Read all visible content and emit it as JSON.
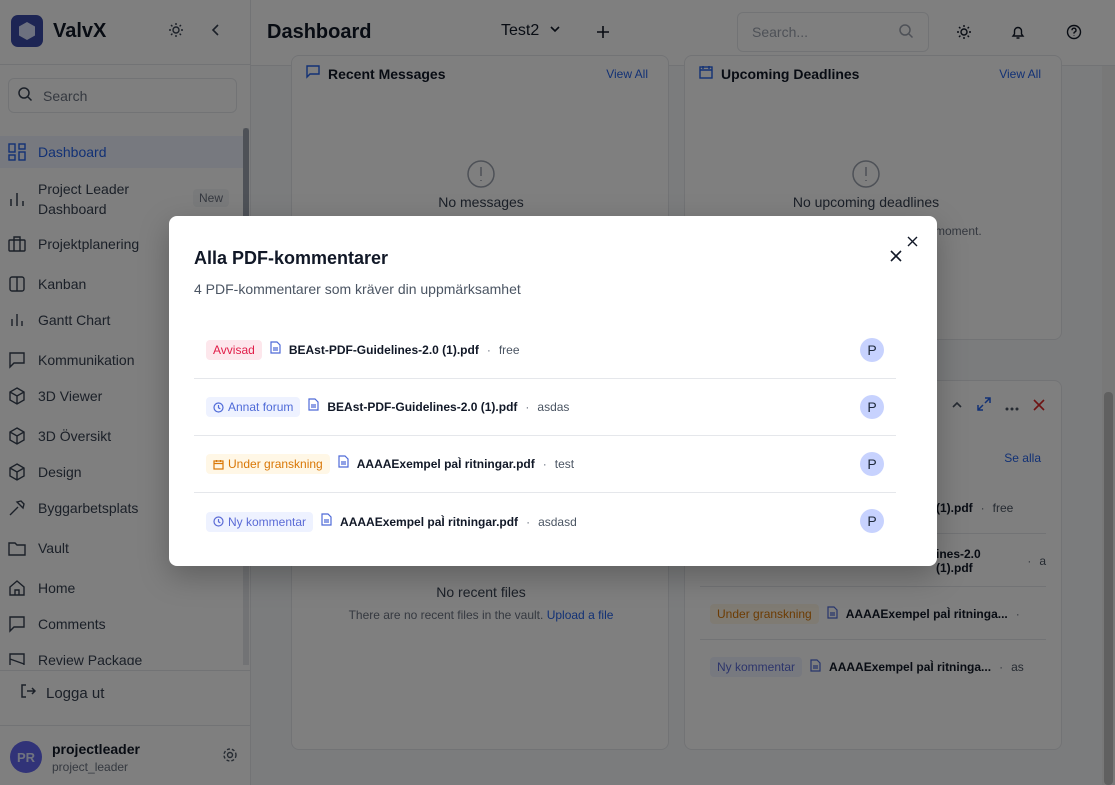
{
  "brand": {
    "name": "ValvX"
  },
  "sidebar": {
    "search_label": "Search",
    "items": [
      {
        "label": "Dashboard",
        "icon": "dashboard-icon",
        "active": true
      },
      {
        "label": "Project Leader Dashboard",
        "icon": "bar-chart-icon",
        "badge": "New"
      },
      {
        "label": "Projektplanering",
        "icon": "briefcase-icon"
      },
      {
        "label": "Kanban",
        "icon": "columns-icon"
      },
      {
        "label": "Gantt Chart",
        "icon": "gantt-icon"
      },
      {
        "label": "Kommunikation",
        "icon": "message-icon"
      },
      {
        "label": "3D Viewer",
        "icon": "cube-icon"
      },
      {
        "label": "3D Översikt",
        "icon": "cube-icon"
      },
      {
        "label": "Design",
        "icon": "cube-icon"
      },
      {
        "label": "Byggarbetsplats",
        "icon": "hammer-icon"
      },
      {
        "label": "Vault",
        "icon": "folder-icon"
      },
      {
        "label": "Home",
        "icon": "home-icon"
      },
      {
        "label": "Comments",
        "icon": "comment-icon"
      },
      {
        "label": "Review Package",
        "icon": "package-icon"
      }
    ],
    "logout_label": "Logga ut",
    "user": {
      "initials": "PR",
      "name": "projectleader",
      "role": "project_leader"
    }
  },
  "header": {
    "title": "Dashboard",
    "project": "Test2",
    "search_placeholder": "Search..."
  },
  "cards": {
    "messages": {
      "title": "Recent Messages",
      "link": "View All",
      "empty_title": "No messages"
    },
    "deadlines": {
      "title": "Upcoming Deadlines",
      "link": "View All",
      "empty_title": "No upcoming deadlines",
      "empty_sub_partial": "moment."
    },
    "files": {
      "empty_title": "No recent files",
      "empty_sub": "There are no recent files in the vault.",
      "empty_link": "Upload a file"
    },
    "comments": {
      "link": "Se alla",
      "rows": [
        {
          "text": "(1).pdf",
          "note": "free"
        },
        {
          "text": "ines-2.0 (1).pdf",
          "note": "a"
        },
        {
          "badge": "Under granskning",
          "file": "AAAAExempel paÌ ritninga...",
          "note": ""
        },
        {
          "badge": "Ny kommentar",
          "file": "AAAAExempel paÌ ritninga...",
          "note": "as"
        }
      ]
    }
  },
  "modal": {
    "title": "Alla PDF-kommentarer",
    "subtitle": "4 PDF-kommentarer som kräver din uppmärksamhet",
    "rows": [
      {
        "status": "Avvisad",
        "status_color": "#e11d48",
        "file": "BEAst-PDF-Guidelines-2.0 (1).pdf",
        "note": "free",
        "avatar": "P"
      },
      {
        "status": "Annat forum",
        "status_color": "#4f6bd8",
        "file": "BEAst-PDF-Guidelines-2.0 (1).pdf",
        "note": "asdas",
        "avatar": "P"
      },
      {
        "status": "Under granskning",
        "status_color": "#d97706",
        "file": "AAAAExempel paÌ ritningar.pdf",
        "note": "test",
        "avatar": "P"
      },
      {
        "status": "Ny kommentar",
        "status_color": "#5b6bd6",
        "file": "AAAAExempel paÌ ritningar.pdf",
        "note": "asdasd",
        "avatar": "P"
      }
    ]
  }
}
